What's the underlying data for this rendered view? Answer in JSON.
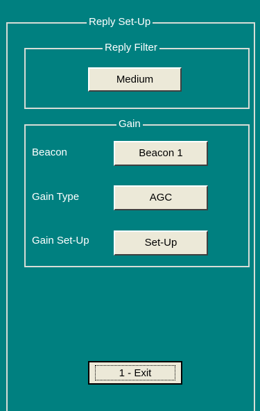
{
  "reply_setup": {
    "title": "Reply Set-Up",
    "reply_filter": {
      "title": "Reply Filter",
      "value": "Medium"
    },
    "gain": {
      "title": "Gain",
      "rows": [
        {
          "label": "Beacon",
          "value": "Beacon 1"
        },
        {
          "label": "Gain Type",
          "value": "AGC"
        },
        {
          "label": "Gain Set-Up",
          "value": "Set-Up"
        }
      ]
    },
    "exit_label": "1 - Exit"
  },
  "colors": {
    "background": "#008080",
    "button_face": "#ece9d8",
    "border": "#d7ddd7"
  }
}
